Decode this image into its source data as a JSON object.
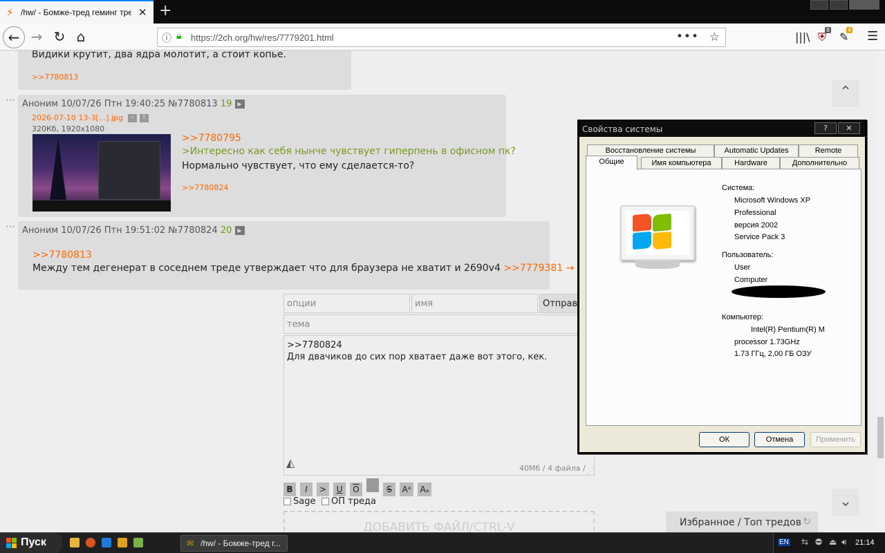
{
  "browser": {
    "tab_title": "/hw/ - Бомже-тред геминг тред",
    "close_glyph": "✕",
    "newtab_glyph": "+",
    "url": "https://2ch.org/hw/res/7779201.html",
    "ublock_count": "8",
    "ext_count": "4"
  },
  "page": {
    "top_post_text": "Видики крутит, два ядра молотит, а стоит копье.",
    "top_post_ref": ">>7780813",
    "post1": {
      "header": "Аноним  10/07/26 Птн 19:40:25  №7780813",
      "reply_num": "19",
      "file_name": "2026-07-10 13-3[...].jpg",
      "file_meta": "320Кб, 1920x1080",
      "ref": ">>7780795",
      "quote": ">Интересно как себя нынче чувствует гиперпень в офисном пк?",
      "text": "Нормально чувствует, что ему сделается-то?",
      "answer_ref": ">>7780824"
    },
    "post2": {
      "header": "Аноним  10/07/26 Птн 19:51:02  №7780824",
      "reply_num": "20",
      "ref": ">>7780813",
      "text": "Между тем дегенерат в соседнем треде утверждает что для браузера не хватит и 2690v4",
      "link": ">>7779381 →"
    },
    "form": {
      "options_placeholder": "опции",
      "name_placeholder": "имя",
      "submit_label": "Отправить",
      "subject_placeholder": "тема",
      "body_line1": ">>7780824",
      "body_line2": "Для двачиков до сих пор хватает даже вот этого, кек.",
      "limits": "40Мб / 4 файла /",
      "markup": [
        "B",
        "I",
        ">",
        "U",
        "O",
        "",
        "S",
        "Aᵃ",
        "Aₐ"
      ],
      "sage_label": "Sage",
      "op_label": "ОП треда",
      "add_file": "ДОБАВИТЬ ФАЙЛ/CTRL-V",
      "favorites": "Избранное / Топ тредов"
    },
    "scroll_up": "⌃",
    "scroll_down": "⌄"
  },
  "dialog": {
    "title": "Свойства системы",
    "help": "?",
    "close": "✕",
    "tabs_row1": [
      "Восстановление системы",
      "Automatic Updates",
      "Remote"
    ],
    "tabs_row2": [
      "Общие",
      "Имя компьютера",
      "Hardware",
      "Дополнительно"
    ],
    "system_label": "Система:",
    "system_lines": [
      "Microsoft Windows XP",
      "Professional",
      "версия 2002",
      "Service Pack 3"
    ],
    "user_label": "Пользователь:",
    "user_lines": [
      "User",
      "Computer"
    ],
    "computer_label": "Компьютер:",
    "computer_lines": [
      "Intel(R) Pentium(R) M",
      "processor 1.73GHz",
      "1.73 ГГц, 2,00 ГБ ОЗУ"
    ],
    "ok": "ОК",
    "cancel": "Отмена",
    "apply": "Применить"
  },
  "taskbar": {
    "start": "Пуск",
    "task_title": "/hw/ - Бомже-тред г...",
    "lang": "EN",
    "clock": "21:14"
  },
  "colors": {
    "accent_orange": "#ff6600",
    "reply_green": "#789922",
    "firefox_blue": "#0a84ff"
  }
}
